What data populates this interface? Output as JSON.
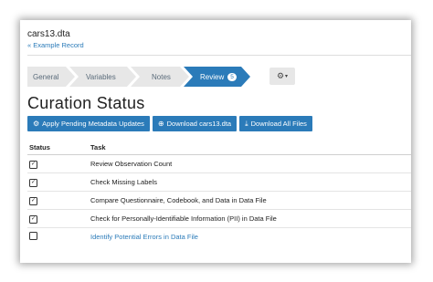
{
  "header": {
    "filename": "cars13.dta",
    "record_link": "« Example Record"
  },
  "wizard": {
    "steps": [
      {
        "label": "General"
      },
      {
        "label": "Variables"
      },
      {
        "label": "Notes"
      },
      {
        "label": "Review",
        "badge": "5"
      }
    ],
    "active": "Review",
    "settings_icon": "gear-icon",
    "settings_caret": "▾"
  },
  "page": {
    "title": "Curation Status"
  },
  "actions": {
    "apply_label": "Apply Pending Metadata Updates",
    "download_label": "Download cars13.dta",
    "download_all_label": "Download All Files",
    "apply_icon": "gear-icon",
    "download_icon": "download-circle-icon",
    "download_all_icon": "download-icon"
  },
  "table": {
    "headers": {
      "status": "Status",
      "task": "Task"
    },
    "rows": [
      {
        "checked": true,
        "task": "Review Observation Count",
        "link": false
      },
      {
        "checked": true,
        "task": "Check Missing Labels",
        "link": false
      },
      {
        "checked": true,
        "task": "Compare Questionnaire, Codebook, and Data in Data File",
        "link": false
      },
      {
        "checked": true,
        "task": "Check for Personally-Identifiable Information (PII) in Data File",
        "link": false
      },
      {
        "checked": false,
        "task": "Identify Potential Errors in Data File",
        "link": true
      }
    ]
  },
  "colors": {
    "accent": "#2b7bb9",
    "step_inactive": "#e7e7e7"
  }
}
